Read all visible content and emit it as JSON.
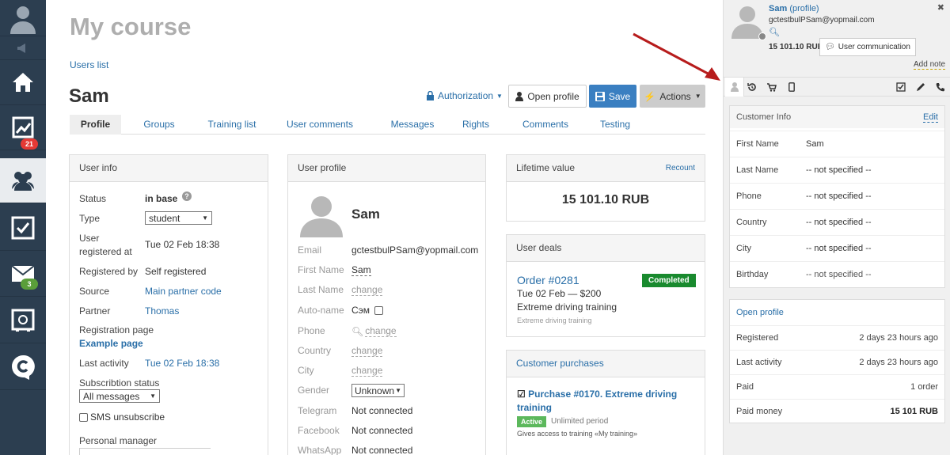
{
  "sidebar": {
    "items": [
      {
        "icon": "user-avatar-icon"
      },
      {
        "icon": "megaphone-icon"
      },
      {
        "icon": "home-icon"
      },
      {
        "icon": "chart-icon",
        "badge": "21",
        "badge_color": "#e74c3c"
      },
      {
        "icon": "users-icon"
      },
      {
        "icon": "tasks-checkbox-icon"
      },
      {
        "icon": "mail-icon",
        "badge": "3",
        "badge_color": "#5a9e3a"
      },
      {
        "icon": "safe-icon"
      },
      {
        "icon": "chat-c-icon"
      }
    ]
  },
  "page": {
    "title": "My course",
    "users_list_link": "Users list",
    "user_name": "Sam",
    "authorization": "Authorization",
    "open_profile": "Open profile",
    "save": "Save",
    "actions": "Actions"
  },
  "tabs": [
    "Profile",
    "Groups",
    "Training list",
    "User comments",
    "Messages",
    "Rights",
    "Comments",
    "Testing"
  ],
  "user_info": {
    "title": "User info",
    "status_label": "Status",
    "status_value": "in base",
    "type_label": "Type",
    "type_value": "student",
    "registered_label_1": "User",
    "registered_label_2": "registered at",
    "registered_value": "Tue 02 Feb 18:38",
    "registered_by_label": "Registered by",
    "registered_by_value": "Self registered",
    "source_label": "Source",
    "source_value": "Main partner code",
    "partner_label": "Partner",
    "partner_value": "Thomas",
    "reg_page_label": "Registration page",
    "reg_page_value": "Example page",
    "last_activity_label": "Last activity",
    "last_activity_value": "Tue 02 Feb 18:38",
    "subscription_label": "Subscribtion status",
    "subscription_value": "All messages",
    "sms_label": "SMS unsubscribe",
    "manager_label": "Personal manager"
  },
  "user_profile": {
    "title": "User profile",
    "name": "Sam",
    "email_label": "Email",
    "email_value": "gctestbulPSam@yopmail.com",
    "first_name_label": "First Name",
    "first_name_value": "Sam",
    "last_name_label": "Last Name",
    "change": "change",
    "autoname_label": "Auto-name",
    "autoname_value": "Сэм",
    "phone_label": "Phone",
    "country_label": "Country",
    "city_label": "City",
    "gender_label": "Gender",
    "gender_value": "Unknown",
    "telegram_label": "Telegram",
    "telegram_value": "Not connected",
    "facebook_label": "Facebook",
    "facebook_value": "Not connected",
    "whatsapp_label": "WhatsApp",
    "whatsapp_value": "Not connected"
  },
  "lifetime": {
    "title": "Lifetime value",
    "recount": "Recount",
    "value": "15 101.10 RUB"
  },
  "deals": {
    "title": "User deals",
    "order": "Order #0281",
    "status": "Completed",
    "date": "Tue 02 Feb — $200",
    "product": "Extreme driving training",
    "product_sub": "Extreme driving training"
  },
  "purchases": {
    "title": "Customer purchases",
    "name": "Purchase #0170. Extreme driving training",
    "status": "Active",
    "period": "Unlimited period",
    "access": "Gives access to training «My training»"
  },
  "right_panel": {
    "name": "Sam",
    "profile": "(profile)",
    "email": "gctestbulPSam@yopmail.com",
    "amount": "15 101.10 RUB",
    "communication": "User communication",
    "add_note": "Add note",
    "customer_info_title": "Customer Info",
    "edit": "Edit",
    "fields": [
      {
        "k": "First Name",
        "v": "Sam"
      },
      {
        "k": "Last Name",
        "v": "-- not specified --"
      },
      {
        "k": "Phone",
        "v": "-- not specified --"
      },
      {
        "k": "Country",
        "v": "-- not specified --"
      },
      {
        "k": "City",
        "v": "-- not specified --"
      },
      {
        "k": "Birthday",
        "v": "-- not specified --"
      }
    ],
    "open_profile": "Open profile",
    "stats": [
      {
        "k": "Registered",
        "v": "2 days 23 hours ago"
      },
      {
        "k": "Last activity",
        "v": "2 days 23 hours ago"
      },
      {
        "k": "Paid",
        "v": "1 order"
      },
      {
        "k": "Paid money",
        "v": "15 101 RUB"
      }
    ]
  },
  "colors": {
    "sidebar": "#2c3e50",
    "save": "#3a7fc1",
    "completed": "#198a2e",
    "active": "#5cb85c",
    "arrow": "#b71c1c"
  }
}
